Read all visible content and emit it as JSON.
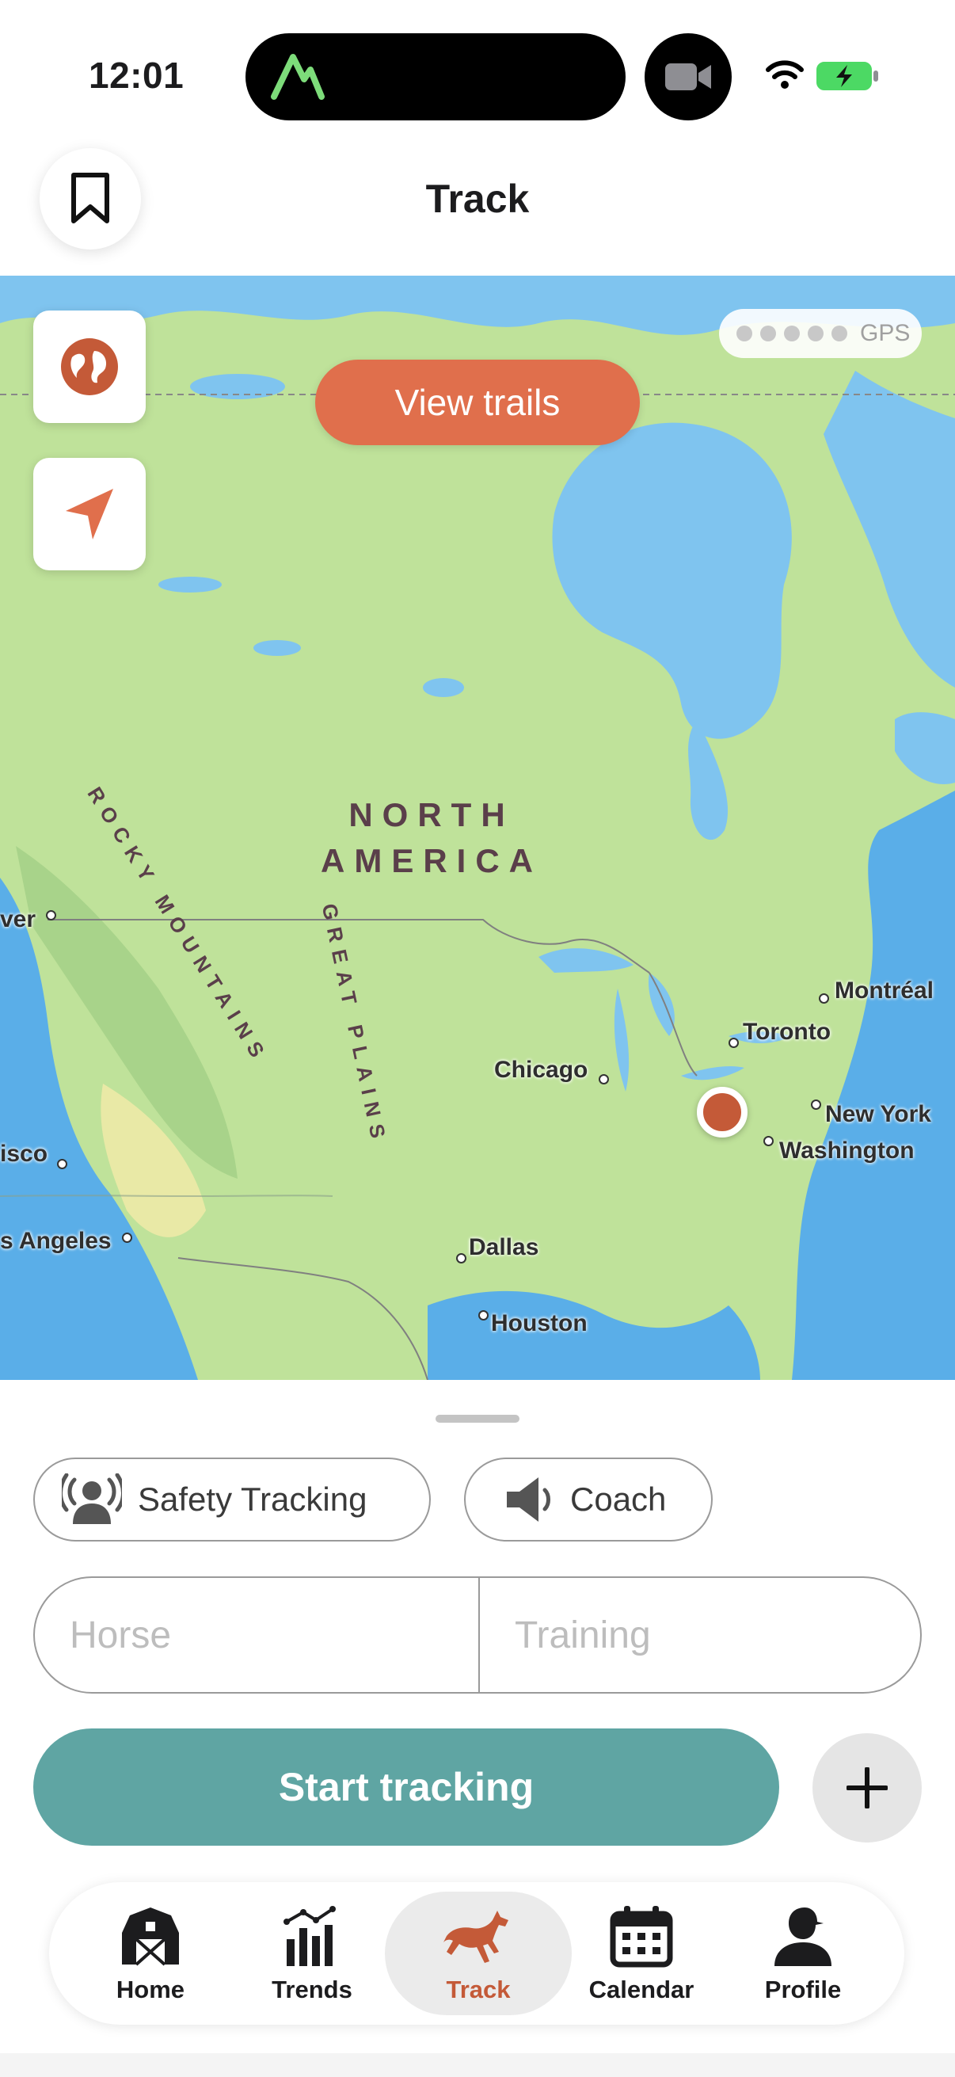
{
  "status_bar": {
    "time": "12:01"
  },
  "header": {
    "title": "Track"
  },
  "map": {
    "view_trails_label": "View trails",
    "gps_label": "GPS",
    "continent_line1": "NORTH",
    "continent_line2": "AMERICA",
    "region_rocky": "ROCKY MOUNTAINS",
    "region_plains": "GREAT PLAINS",
    "cities": {
      "vancouver": "ver",
      "san_francisco": "isco",
      "los_angeles": "s Angeles",
      "chicago": "Chicago",
      "dallas": "Dallas",
      "houston": "Houston",
      "toronto": "Toronto",
      "montreal": "Montréal",
      "new_york": "New York",
      "washington": "Washington"
    }
  },
  "sheet": {
    "safety_tracking_label": "Safety Tracking",
    "coach_label": "Coach",
    "horse_placeholder": "Horse",
    "training_placeholder": "Training",
    "start_tracking_label": "Start tracking"
  },
  "tabs": [
    {
      "label": "Home"
    },
    {
      "label": "Trends"
    },
    {
      "label": "Track"
    },
    {
      "label": "Calendar"
    },
    {
      "label": "Profile"
    }
  ],
  "colors": {
    "accent": "#c45a38",
    "view_trails": "#e06f4c",
    "start_button": "#5fa5a3",
    "water": "#7fc4ef",
    "land": "#bfe29a"
  },
  "icons": {
    "bookmark": "bookmark-icon",
    "globe": "globe-icon",
    "locate": "location-arrow-icon",
    "safety": "person-broadcast-icon",
    "coach": "speaker-icon",
    "plus": "plus-icon",
    "home": "barn-icon",
    "trends": "bar-chart-icon",
    "track": "horse-icon",
    "calendar": "calendar-icon",
    "profile": "person-cap-icon"
  }
}
